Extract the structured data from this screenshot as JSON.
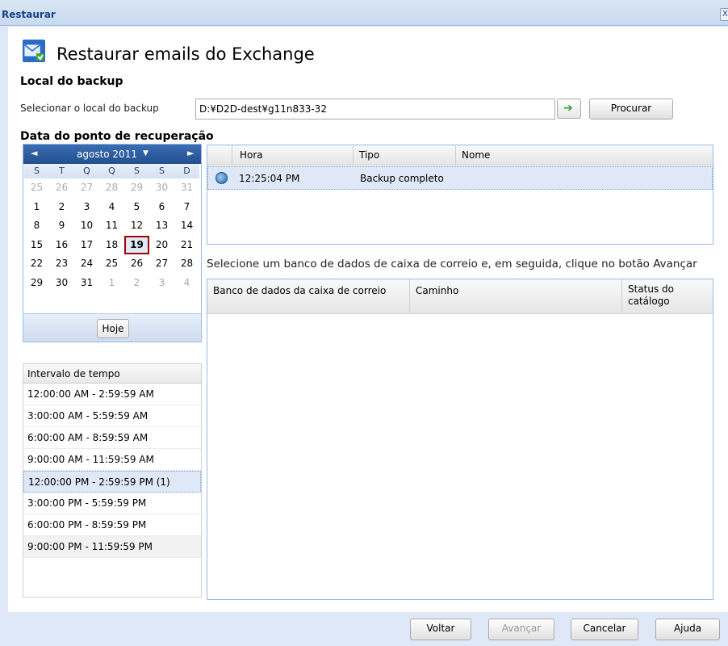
{
  "window": {
    "title": "Restaurar",
    "close_glyph": "X"
  },
  "header": {
    "title": "Restaurar emails do Exchange",
    "icon": "exchange-restore-icon"
  },
  "backup_location": {
    "section_title": "Local do backup",
    "label": "Selecionar o local do backup",
    "path_value": "D:¥D2D-dest¥g11n833-32",
    "go_glyph": "➔",
    "browse_label": "Procurar"
  },
  "recovery_point": {
    "section_title": "Data do ponto de recuperação"
  },
  "calendar": {
    "month_label": "agosto 2011",
    "prev_glyph": "◄",
    "next_glyph": "►",
    "dropdown_glyph": "▼",
    "day_headers": [
      "S",
      "T",
      "Q",
      "Q",
      "S",
      "S",
      "D"
    ],
    "weeks": [
      [
        "25",
        "26",
        "27",
        "28",
        "29",
        "30",
        "31"
      ],
      [
        "1",
        "2",
        "3",
        "4",
        "5",
        "6",
        "7"
      ],
      [
        "8",
        "9",
        "10",
        "11",
        "12",
        "13",
        "14"
      ],
      [
        "15",
        "16",
        "17",
        "18",
        "19",
        "20",
        "21"
      ],
      [
        "22",
        "23",
        "24",
        "25",
        "26",
        "27",
        "28"
      ],
      [
        "29",
        "30",
        "31",
        "1",
        "2",
        "3",
        "4"
      ]
    ],
    "selected_day": "19",
    "today_label": "Hoje"
  },
  "time_ranges": {
    "header": "Intervalo de tempo",
    "items": [
      "12:00:00 AM - 2:59:59 AM",
      "3:00:00 AM - 5:59:59 AM",
      "6:00:00 AM - 8:59:59 AM",
      "9:00:00 AM - 11:59:59 AM",
      "12:00:00 PM - 2:59:59 PM (1)",
      "3:00:00 PM - 5:59:59 PM",
      "6:00:00 PM - 8:59:59 PM",
      "9:00:00 PM - 11:59:59 PM"
    ]
  },
  "recovery_points_grid": {
    "columns": [
      "Hora",
      "Tipo",
      "Nome"
    ],
    "rows": [
      {
        "icon": "backup-point-icon",
        "hora": "12:25:04 PM",
        "tipo": "Backup completo",
        "nome": ""
      }
    ]
  },
  "instruction": "Selecione um banco de dados de caixa de correio e, em seguida, clique no botão Avançar",
  "mailbox_grid": {
    "columns": [
      "Banco de dados da caixa de correio",
      "Caminho",
      "Status do catálogo"
    ],
    "rows": []
  },
  "footer": {
    "back_label": "Voltar",
    "next_label": "Avançar",
    "cancel_label": "Cancelar",
    "help_label": "Ajuda"
  },
  "colors": {
    "title_text": "#15428b",
    "calendar_header": "#23508f",
    "selection": "#dfe8f6",
    "selected_day_border": "#a30000",
    "go_arrow": "#2e9e2e"
  }
}
